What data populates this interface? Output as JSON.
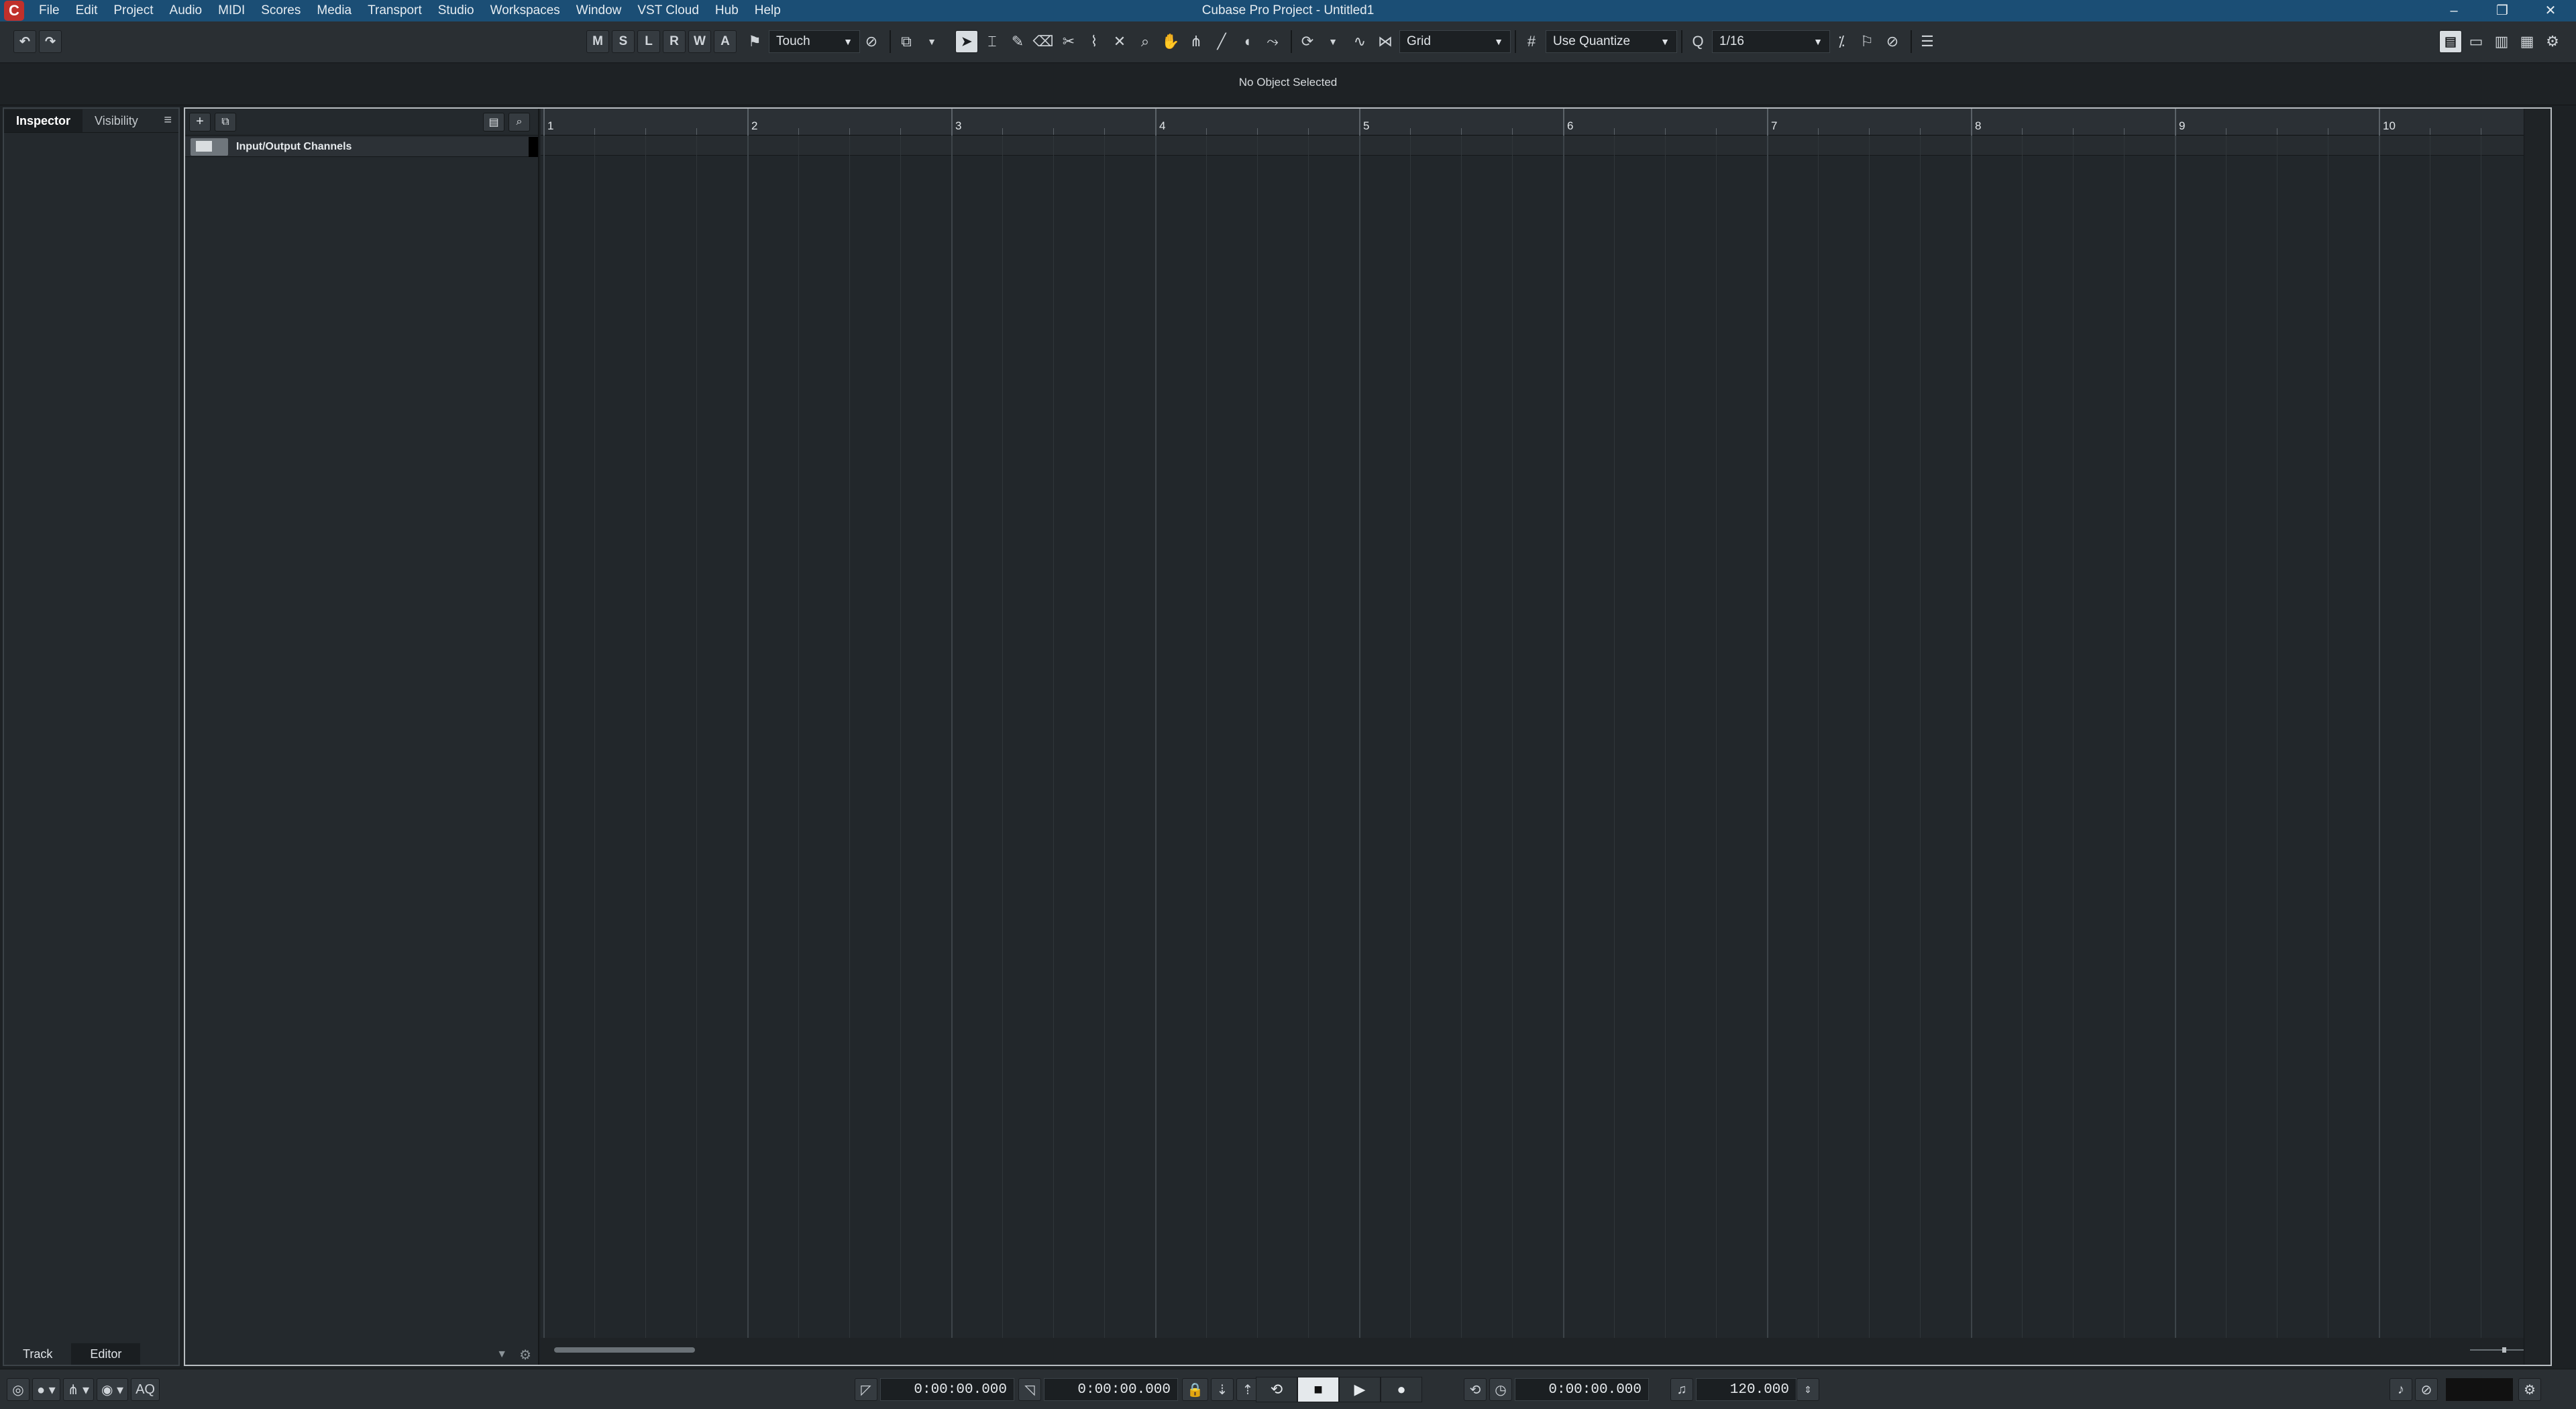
{
  "window": {
    "title": "Cubase Pro Project - Untitled1",
    "logo_glyph": "C",
    "controls": {
      "minimize": "–",
      "restore": "❐",
      "close": "✕"
    }
  },
  "menu": [
    "File",
    "Edit",
    "Project",
    "Audio",
    "MIDI",
    "Scores",
    "Media",
    "Transport",
    "Studio",
    "Workspaces",
    "Window",
    "VST Cloud",
    "Hub",
    "Help"
  ],
  "toolbar": {
    "undo_icon": "↶",
    "redo_icon": "↷",
    "state_buttons": [
      "M",
      "S",
      "L",
      "R",
      "W",
      "A"
    ],
    "automation_mode": "Touch",
    "snap_type": "Grid",
    "quantize_type": "Use Quantize",
    "quantize_value": "1/16",
    "tool_icons": [
      "object-selection",
      "range-selection",
      "split",
      "glue",
      "erase",
      "zoom",
      "mute",
      "draw",
      "line",
      "play",
      "comp"
    ],
    "accent_color": "#1b4e75"
  },
  "infoline": {
    "text": "No Object Selected"
  },
  "left_zone": {
    "tabs": [
      "Inspector",
      "Visibility"
    ],
    "active_tab": "Inspector",
    "menu_icon": "≡",
    "bottom_tabs": [
      "Track",
      "Editor"
    ],
    "active_bottom_tab": "Editor"
  },
  "tracklist": {
    "add_icon": "+",
    "tracks": [
      {
        "name": "Input/Output Channels",
        "type": "folder"
      }
    ],
    "footer_icons": [
      "chevron-down",
      "gear"
    ]
  },
  "ruler": {
    "bars": [
      "1",
      "2",
      "3",
      "4",
      "5",
      "6",
      "7",
      "8",
      "9",
      "10"
    ]
  },
  "transport": {
    "left_locator": "0:00:00.000",
    "right_locator": "0:00:00.000",
    "position": "0:00:00.000",
    "tempo": "120.000",
    "aq_label": "AQ",
    "buttons": {
      "cycle": "⟲",
      "stop": "■",
      "play": "▶",
      "record": "●"
    },
    "active_button": "stop"
  }
}
